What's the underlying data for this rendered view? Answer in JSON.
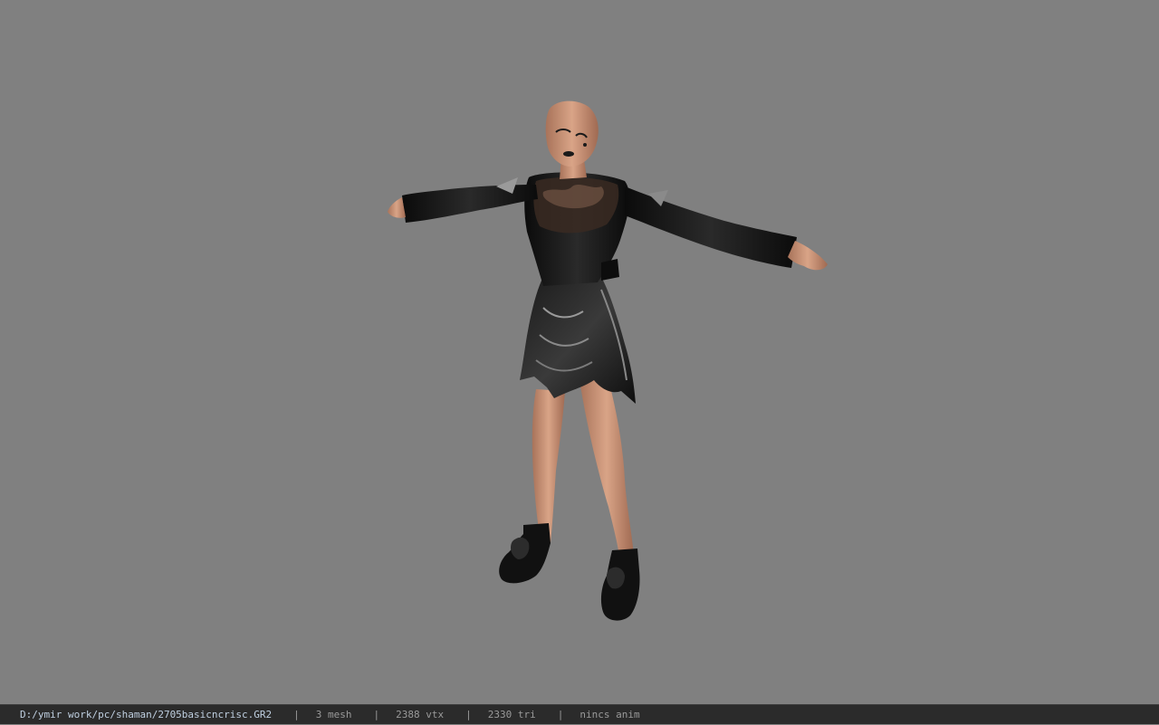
{
  "viewer": {
    "background_color": "#808080",
    "model": {
      "description": "3D character model in T-pose: female figure with dark lace top, long black sleeves, black armored skirt and black boots"
    }
  },
  "status_bar": {
    "file_path": "D:/ymir work/pc/shaman/2705basicncrisc.GR2",
    "mesh_count": "3 mesh",
    "vertex_count": "2388 vtx",
    "triangle_count": "2330 tri",
    "anim_status": "nincs anim",
    "separator": "|"
  }
}
